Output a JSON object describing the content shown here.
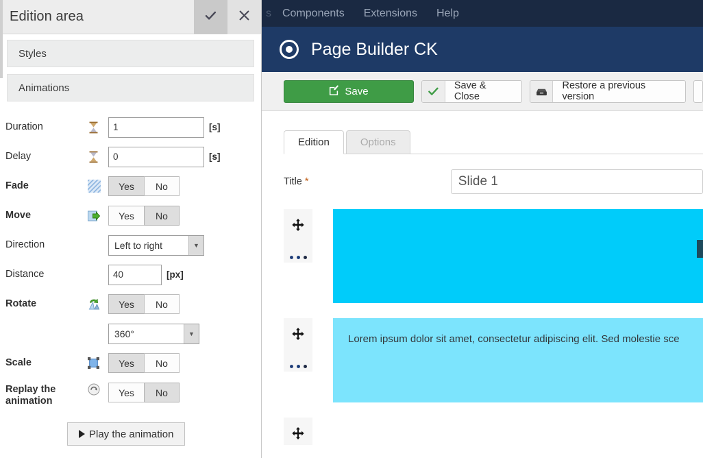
{
  "left_panel": {
    "title": "Edition area",
    "apply_icon": "check-icon",
    "close_icon": "close-icon",
    "accordions": [
      {
        "label": "Styles"
      },
      {
        "label": "Animations"
      }
    ],
    "fields": {
      "duration": {
        "label": "Duration",
        "value": "1",
        "unit": "[s]",
        "icon": "hourglass-icon"
      },
      "delay": {
        "label": "Delay",
        "value": "0",
        "unit": "[s]",
        "icon": "hourglass-icon"
      },
      "fade": {
        "label": "Fade",
        "icon": "fade-hatch-icon",
        "yes": "Yes",
        "no": "No",
        "selected": "Yes"
      },
      "move": {
        "label": "Move",
        "icon": "move-arrow-icon",
        "yes": "Yes",
        "no": "No",
        "selected": "No"
      },
      "direction": {
        "label": "Direction",
        "value": "Left to right"
      },
      "distance": {
        "label": "Distance",
        "value": "40",
        "unit": "[px]"
      },
      "rotate": {
        "label": "Rotate",
        "icon": "rotate-icon",
        "yes": "Yes",
        "no": "No",
        "selected": "Yes"
      },
      "rotate_angle": {
        "value": "360°"
      },
      "scale": {
        "label": "Scale",
        "icon": "scale-icon",
        "yes": "Yes",
        "no": "No",
        "selected": "Yes"
      },
      "replay": {
        "label_line1": "Replay the",
        "label_line2": "animation",
        "icon": "replay-icon",
        "yes": "Yes",
        "no": "No",
        "selected": "No"
      }
    },
    "play_button": "Play the animation"
  },
  "app": {
    "menubar": [
      {
        "label": "Components"
      },
      {
        "label": "Extensions"
      },
      {
        "label": "Help"
      }
    ],
    "header": {
      "title": "Page Builder CK",
      "logo_icon": "target-circle-icon"
    },
    "toolbar": {
      "save": "Save",
      "save_icon": "edit-square-icon",
      "save_close": "Save & Close",
      "save_close_icon": "check-icon",
      "restore": "Restore a previous version",
      "restore_icon": "archive-box-icon"
    },
    "tabs": [
      {
        "label": "Edition",
        "active": true
      },
      {
        "label": "Options",
        "active": false
      }
    ],
    "title_field": {
      "label": "Title",
      "required_mark": "*",
      "value": "Slide 1"
    },
    "blocks": [
      {
        "type": "image",
        "handle_icon": "move-cross-icon",
        "menu_icon": "ellipsis-icon",
        "color": "#00ccfa"
      },
      {
        "type": "text",
        "handle_icon": "move-cross-icon",
        "menu_icon": "ellipsis-icon",
        "color": "#7ce4fd",
        "text": "Lorem ipsum dolor sit amet, consectetur adipiscing elit. Sed molestie sce"
      },
      {
        "type": "empty",
        "handle_icon": "move-cross-icon"
      }
    ]
  },
  "colors": {
    "menubar": "#1a2942",
    "titlebar": "#1e3a66",
    "save_green": "#3f9c46",
    "block_cyan": "#00ccfa",
    "block_light_cyan": "#7ce4fd"
  }
}
